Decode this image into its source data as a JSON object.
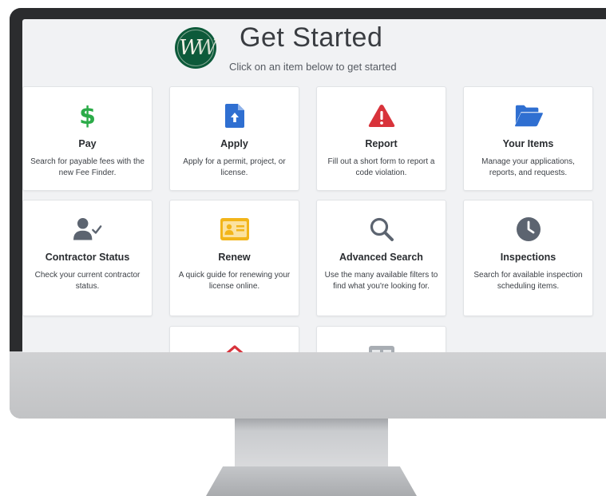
{
  "header": {
    "title": "Get Started",
    "subtitle": "Click on an item below to get started",
    "logo_text": "W"
  },
  "cards": [
    {
      "label": "Pay",
      "desc": "Search for payable fees with the new Fee Finder.",
      "icon": "dollar-icon",
      "color": "#2bab48"
    },
    {
      "label": "Apply",
      "desc": "Apply for a permit, project, or license.",
      "icon": "file-upload-icon",
      "color": "#2f6fd1"
    },
    {
      "label": "Report",
      "desc": "Fill out a short form to report a code violation.",
      "icon": "warning-icon",
      "color": "#d8333b"
    },
    {
      "label": "Your Items",
      "desc": "Manage your applications, reports, and requests.",
      "icon": "folder-open-icon",
      "color": "#2f6fd1"
    },
    {
      "label": "Contractor Status",
      "desc": "Check your current contractor status.",
      "icon": "user-check-icon",
      "color": "#5c6470"
    },
    {
      "label": "Renew",
      "desc": "A quick guide for renewing your license online.",
      "icon": "id-card-icon",
      "color": "#f2b51a"
    },
    {
      "label": "Advanced Search",
      "desc": "Use the many available filters to find what you're looking for.",
      "icon": "search-icon",
      "color": "#5c6470"
    },
    {
      "label": "Inspections",
      "desc": "Search for available inspection scheduling items.",
      "icon": "clock-icon",
      "color": "#5c6470"
    },
    {
      "label": "",
      "desc": "",
      "icon": "home-icon",
      "color": "#d8333b"
    },
    {
      "label": "",
      "desc": "",
      "icon": "grid-icon",
      "color": "#9ea3aa"
    }
  ],
  "pay_symbol": "$"
}
